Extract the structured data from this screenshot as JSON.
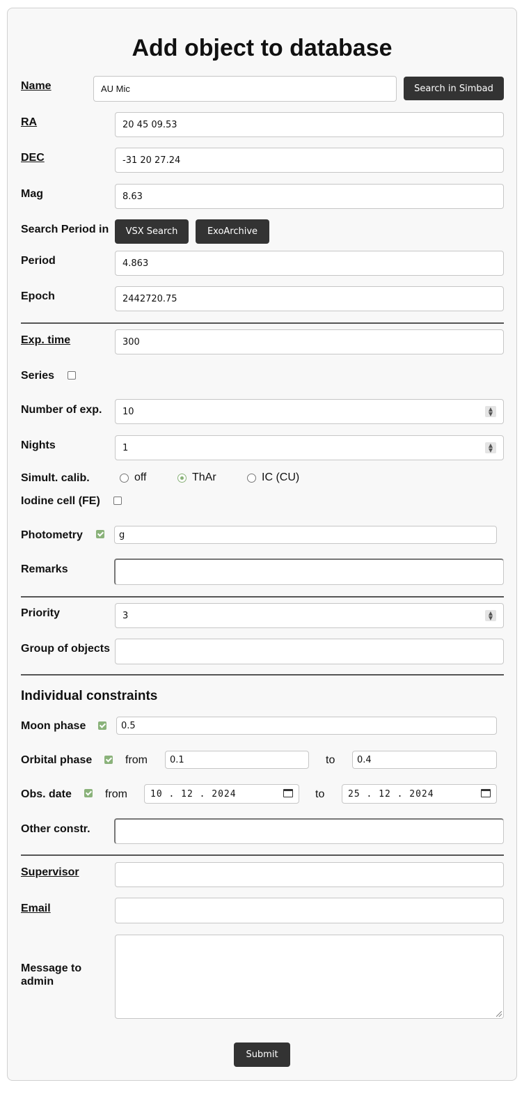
{
  "title": "Add object to database",
  "fields": {
    "name": {
      "label": "Name",
      "value": "AU Mic"
    },
    "simbad_button": "Search in Simbad",
    "ra": {
      "label": "RA",
      "value": "20 45 09.53"
    },
    "dec": {
      "label": "DEC",
      "value": "-31 20 27.24"
    },
    "mag": {
      "label": "Mag",
      "value": "8.63"
    },
    "search_period": {
      "label": "Search Period in",
      "vsx": "VSX Search",
      "exo": "ExoArchive"
    },
    "period": {
      "label": "Period",
      "value": "4.863"
    },
    "epoch": {
      "label": "Epoch",
      "value": "2442720.75"
    },
    "exp_time": {
      "label": "Exp. time",
      "value": "300"
    },
    "series": {
      "label": "Series",
      "checked": false
    },
    "num_exp": {
      "label": "Number of exp.",
      "value": "10"
    },
    "nights": {
      "label": "Nights",
      "value": "1"
    },
    "simult_calib": {
      "label": "Simult. calib.",
      "options": [
        "off",
        "ThAr",
        "IC (CU)"
      ],
      "selected": "ThAr"
    },
    "iodine": {
      "label": "Iodine cell (FE)",
      "checked": false
    },
    "photometry": {
      "label": "Photometry",
      "checked": true,
      "value": "g"
    },
    "remarks": {
      "label": "Remarks",
      "value": ""
    },
    "priority": {
      "label": "Priority",
      "value": "3"
    },
    "group": {
      "label": "Group of objects",
      "value": ""
    }
  },
  "constraints": {
    "heading": "Individual constraints",
    "moon": {
      "label": "Moon phase",
      "checked": true,
      "value": "0.5"
    },
    "orbital": {
      "label": "Orbital phase",
      "checked": true,
      "from_label": "from",
      "from": "0.1",
      "to_label": "to",
      "to": "0.4"
    },
    "obs_date": {
      "label": "Obs. date",
      "checked": true,
      "from_label": "from",
      "from": "10 . 12 . 2024",
      "to_label": "to",
      "to": "25 . 12 . 2024"
    },
    "other": {
      "label": "Other constr.",
      "value": ""
    }
  },
  "contact": {
    "supervisor": {
      "label": "Supervisor",
      "value": ""
    },
    "email": {
      "label": "Email",
      "value": ""
    },
    "message": {
      "label": "Message to admin",
      "value": ""
    },
    "submit": "Submit"
  },
  "colors": {
    "accent": "#8ab27a",
    "button": "#333333"
  }
}
